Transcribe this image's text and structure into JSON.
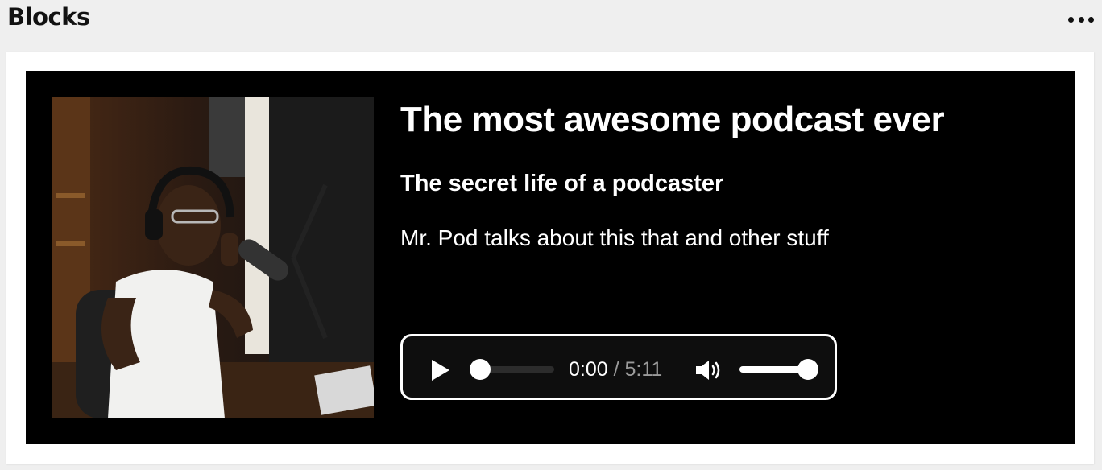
{
  "header": {
    "title": "Blocks",
    "menu_icon": "more-horizontal-icon"
  },
  "block": {
    "cover_image": "podcaster-with-headphones-photo",
    "podcast_title": "The most awesome podcast ever",
    "episode_title": "The secret life of a podcaster",
    "description": "Mr. Pod talks about this that and other stuff",
    "player": {
      "play_icon": "play-icon",
      "volume_icon": "volume-icon",
      "current_time": "0:00",
      "separator": "/",
      "duration": "5:11",
      "progress": 0,
      "volume": 0.92
    }
  }
}
